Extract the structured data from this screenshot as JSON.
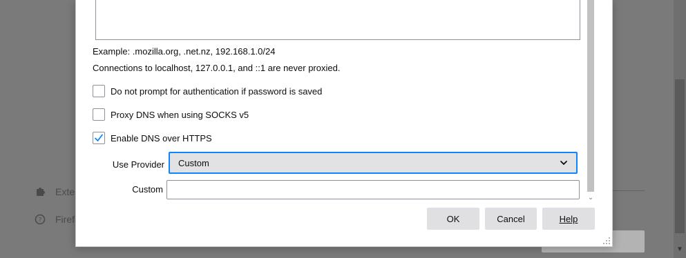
{
  "background": {
    "items": [
      {
        "label": "Exter",
        "icon": "puzzle-piece-icon"
      },
      {
        "label": "Firefo",
        "icon": "help-circle-icon"
      }
    ]
  },
  "dialog": {
    "example_text": "Example: .mozilla.org, .net.nz, 192.168.1.0/24",
    "localhost_note": "Connections to localhost, 127.0.0.1, and ::1 are never proxied.",
    "checkboxes": [
      {
        "label": "Do not prompt for authentication if password is saved",
        "checked": false
      },
      {
        "label": "Proxy DNS when using SOCKS v5",
        "checked": false
      },
      {
        "label": "Enable DNS over HTTPS",
        "checked": true
      }
    ],
    "provider": {
      "label": "Use Provider",
      "selected": "Custom"
    },
    "custom": {
      "label": "Custom",
      "value": ""
    },
    "buttons": {
      "ok": "OK",
      "cancel": "Cancel",
      "help": "Help"
    }
  },
  "colors": {
    "accent": "#0a84ff",
    "overlay": "#7a7a7a",
    "button_bg": "#e0e0e2"
  }
}
